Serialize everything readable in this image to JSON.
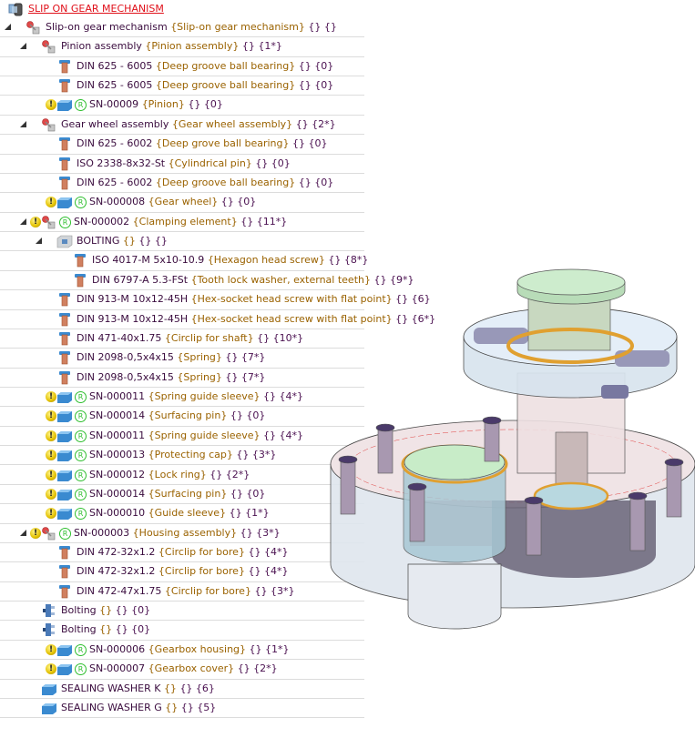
{
  "header": {
    "title": "SLIP ON GEAR MECHANISM",
    "icon": "assembly-file-icon"
  },
  "colors": {
    "title": "#e0101a",
    "name": "#3a0c3e",
    "description": "#9a6200",
    "suffix": "#4a1050",
    "released": "#2fbf2f",
    "warning": "#e2c000"
  },
  "tree": [
    {
      "level": 0,
      "expand": "open",
      "warn": false,
      "icon": "assembly",
      "released": false,
      "name": "Slip-on gear mechanism",
      "desc": "{Slip-on gear mechanism}",
      "rest": "{} {}"
    },
    {
      "level": 1,
      "expand": "open",
      "warn": false,
      "icon": "assembly",
      "released": false,
      "name": "Pinion assembly",
      "desc": "{Pinion assembly}",
      "rest": "{} {1*}"
    },
    {
      "level": 2,
      "expand": "none",
      "warn": false,
      "icon": "standard-part",
      "released": false,
      "name": "DIN 625 - 6005",
      "desc": "{Deep groove ball bearing}",
      "rest": "{} {0}"
    },
    {
      "level": 2,
      "expand": "none",
      "warn": false,
      "icon": "standard-part",
      "released": false,
      "name": "DIN 625 - 6005",
      "desc": "{Deep groove ball bearing}",
      "rest": "{} {0}"
    },
    {
      "level": 2,
      "expand": "none",
      "warn": true,
      "icon": "part",
      "released": true,
      "name": "SN-00009",
      "desc": "{Pinion}",
      "rest": "{} {0}"
    },
    {
      "level": 1,
      "expand": "open",
      "warn": false,
      "icon": "assembly",
      "released": false,
      "name": "Gear wheel assembly",
      "desc": "{Gear wheel assembly}",
      "rest": "{} {2*}"
    },
    {
      "level": 2,
      "expand": "none",
      "warn": false,
      "icon": "standard-part",
      "released": false,
      "name": "DIN 625 - 6002",
      "desc": "{Deep grove ball bearing}",
      "rest": "{} {0}"
    },
    {
      "level": 2,
      "expand": "none",
      "warn": false,
      "icon": "standard-part",
      "released": false,
      "name": "ISO 2338-8x32-St",
      "desc": "{Cylindrical pin}",
      "rest": "{} {0}"
    },
    {
      "level": 2,
      "expand": "none",
      "warn": false,
      "icon": "standard-part",
      "released": false,
      "name": "DIN 625 - 6002",
      "desc": "{Deep groove ball bearing}",
      "rest": "{} {0}"
    },
    {
      "level": 2,
      "expand": "none",
      "warn": true,
      "icon": "part",
      "released": true,
      "name": "SN-000008",
      "desc": "{Gear wheel}",
      "rest": "{} {0}"
    },
    {
      "level": 1,
      "expand": "open",
      "warn": true,
      "icon": "assembly",
      "released": true,
      "name": "SN-000002",
      "desc": "{Clamping element}",
      "rest": "{} {11*}"
    },
    {
      "level": 2,
      "expand": "open",
      "warn": false,
      "icon": "bolting-group",
      "released": false,
      "name": "BOLTING",
      "desc": "{}",
      "rest": "{} {}"
    },
    {
      "level": 3,
      "expand": "none",
      "warn": false,
      "icon": "standard-part",
      "released": false,
      "name": "ISO 4017-M 5x10-10.9",
      "desc": "{Hexagon head screw}",
      "rest": "{} {8*}"
    },
    {
      "level": 3,
      "expand": "none",
      "warn": false,
      "icon": "standard-part",
      "released": false,
      "name": "DIN 6797-A 5.3-FSt",
      "desc": "{Tooth lock washer, external teeth}",
      "rest": "{} {9*}"
    },
    {
      "level": 2,
      "expand": "none",
      "warn": false,
      "icon": "standard-part",
      "released": false,
      "name": "DIN 913-M 10x12-45H",
      "desc": "{Hex-socket head screw with flat point}",
      "rest": "{} {6}"
    },
    {
      "level": 2,
      "expand": "none",
      "warn": false,
      "icon": "standard-part",
      "released": false,
      "name": "DIN 913-M 10x12-45H",
      "desc": "{Hex-socket head screw with flat point}",
      "rest": "{} {6*}"
    },
    {
      "level": 2,
      "expand": "none",
      "warn": false,
      "icon": "standard-part",
      "released": false,
      "name": "DIN 471-40x1.75",
      "desc": "{Circlip for shaft}",
      "rest": "{} {10*}"
    },
    {
      "level": 2,
      "expand": "none",
      "warn": false,
      "icon": "standard-part",
      "released": false,
      "name": "DIN 2098-0,5x4x15",
      "desc": "{Spring}",
      "rest": "{} {7*}"
    },
    {
      "level": 2,
      "expand": "none",
      "warn": false,
      "icon": "standard-part",
      "released": false,
      "name": "DIN 2098-0,5x4x15",
      "desc": "{Spring}",
      "rest": "{} {7*}"
    },
    {
      "level": 2,
      "expand": "none",
      "warn": true,
      "icon": "part",
      "released": true,
      "name": "SN-000011",
      "desc": "{Spring guide sleeve}",
      "rest": "{} {4*}"
    },
    {
      "level": 2,
      "expand": "none",
      "warn": true,
      "icon": "part",
      "released": true,
      "name": "SN-000014",
      "desc": "{Surfacing pin}",
      "rest": "{} {0}"
    },
    {
      "level": 2,
      "expand": "none",
      "warn": true,
      "icon": "part",
      "released": true,
      "name": "SN-000011",
      "desc": "{Spring guide sleeve}",
      "rest": "{} {4*}"
    },
    {
      "level": 2,
      "expand": "none",
      "warn": true,
      "icon": "part",
      "released": true,
      "name": "SN-000013",
      "desc": "{Protecting cap}",
      "rest": "{} {3*}"
    },
    {
      "level": 2,
      "expand": "none",
      "warn": true,
      "icon": "part",
      "released": true,
      "name": "SN-000012",
      "desc": "{Lock ring}",
      "rest": "{} {2*}"
    },
    {
      "level": 2,
      "expand": "none",
      "warn": true,
      "icon": "part",
      "released": true,
      "name": "SN-000014",
      "desc": "{Surfacing pin}",
      "rest": "{} {0}"
    },
    {
      "level": 2,
      "expand": "none",
      "warn": true,
      "icon": "part",
      "released": true,
      "name": "SN-000010",
      "desc": "{Guide sleeve}",
      "rest": "{} {1*}"
    },
    {
      "level": 1,
      "expand": "open",
      "warn": true,
      "icon": "assembly",
      "released": true,
      "name": "SN-000003",
      "desc": "{Housing assembly}",
      "rest": "{} {3*}"
    },
    {
      "level": 2,
      "expand": "none",
      "warn": false,
      "icon": "standard-part",
      "released": false,
      "name": "DIN 472-32x1.2",
      "desc": "{Circlip for bore}",
      "rest": "{} {4*}"
    },
    {
      "level": 2,
      "expand": "none",
      "warn": false,
      "icon": "standard-part",
      "released": false,
      "name": "DIN 472-32x1.2",
      "desc": "{Circlip for bore}",
      "rest": "{} {4*}"
    },
    {
      "level": 2,
      "expand": "none",
      "warn": false,
      "icon": "standard-part",
      "released": false,
      "name": "DIN 472-47x1.75",
      "desc": "{Circlip for bore}",
      "rest": "{} {3*}"
    },
    {
      "level": 1,
      "expand": "closed",
      "warn": false,
      "icon": "bolting",
      "released": false,
      "name": "Bolting ",
      "desc": "{}",
      "rest": "{} {0}"
    },
    {
      "level": 1,
      "expand": "closed",
      "warn": false,
      "icon": "bolting",
      "released": false,
      "name": "Bolting ",
      "desc": "{}",
      "rest": "{} {0}"
    },
    {
      "level": 2,
      "expand": "none",
      "warn": true,
      "icon": "part",
      "released": true,
      "name": "SN-000006",
      "desc": "{Gearbox housing}",
      "rest": "{} {1*}"
    },
    {
      "level": 2,
      "expand": "none",
      "warn": true,
      "icon": "part",
      "released": true,
      "name": "SN-000007",
      "desc": "{Gearbox cover}",
      "rest": "{} {2*}"
    },
    {
      "level": 1,
      "expand": "none",
      "warn": false,
      "icon": "part",
      "released": false,
      "name": "SEALING WASHER K",
      "desc": "{}",
      "rest": "{} {6}"
    },
    {
      "level": 1,
      "expand": "none",
      "warn": false,
      "icon": "part",
      "released": false,
      "name": "SEALING WASHER G",
      "desc": "{}",
      "rest": "{} {5}"
    }
  ],
  "model_view": {
    "icon": "3d-model-view"
  }
}
